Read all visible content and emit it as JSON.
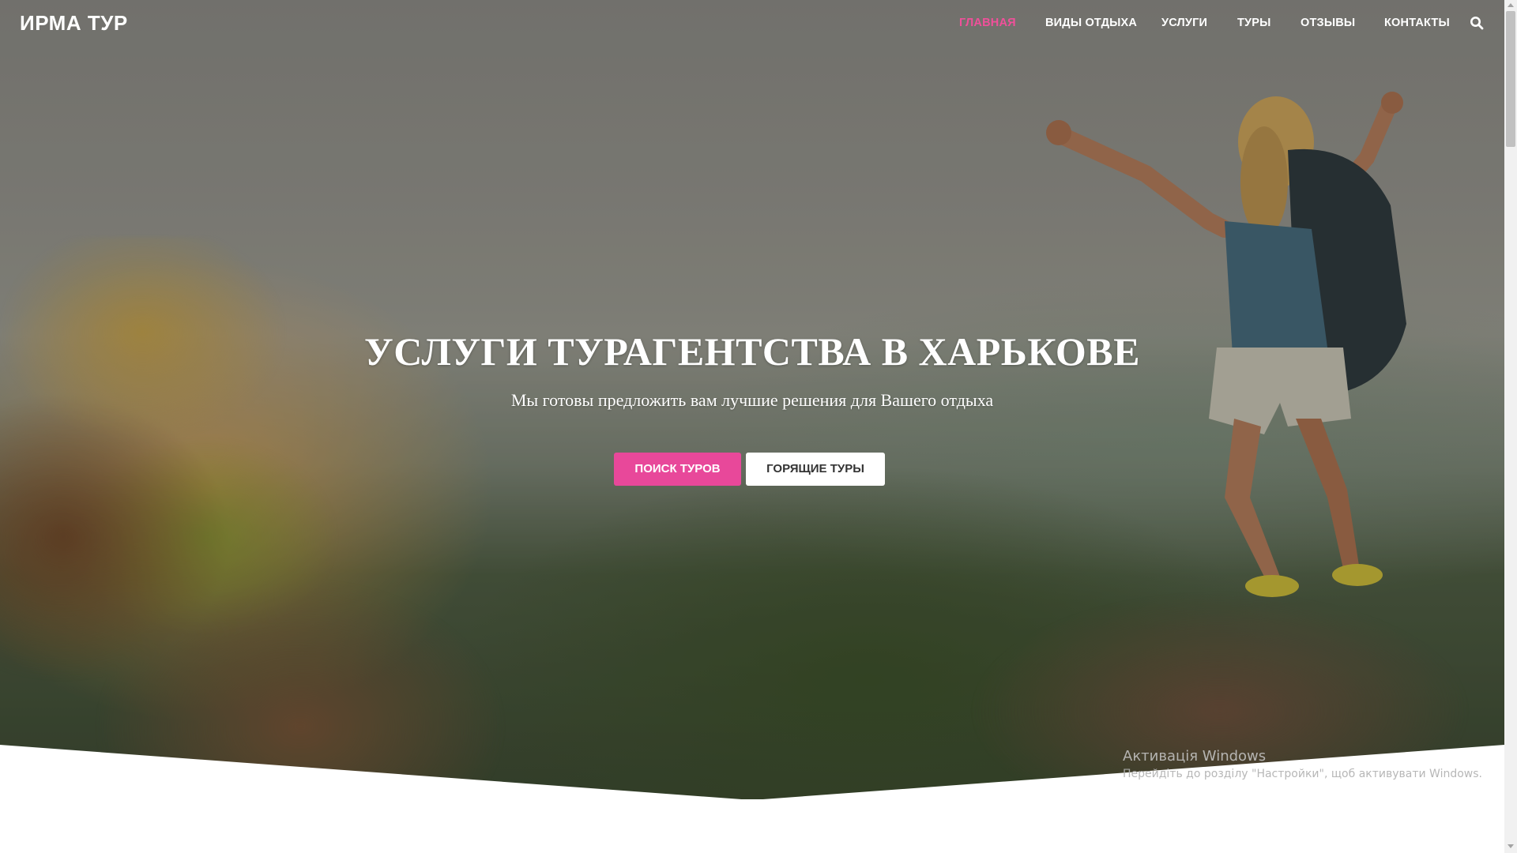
{
  "brand": {
    "logo_text": "ИРМА ТУР"
  },
  "nav": {
    "items": [
      {
        "label": "ГЛАВНАЯ",
        "active": true
      },
      {
        "label": "ВИДЫ ОТДЫХА",
        "active": false
      },
      {
        "label": "УСЛУГИ",
        "active": false
      },
      {
        "label": "ТУРЫ",
        "active": false
      },
      {
        "label": "ОТЗЫВЫ",
        "active": false
      },
      {
        "label": "КОНТАКТЫ",
        "active": false
      }
    ],
    "search_icon": "search-icon",
    "active_color": "#f0509a"
  },
  "hero": {
    "title": "УСЛУГИ ТУРАГЕНТСТВА В ХАРЬКОВЕ",
    "subtitle": "Мы готовы предложить вам лучшие решения для Вашего отдыха",
    "primary_button": "ПОИСК ТУРОВ",
    "secondary_button": "ГОРЯЩИЕ ТУРЫ",
    "primary_color": "#e8489a"
  },
  "watermark": {
    "title": "Активація Windows",
    "subtitle": "Перейдіть до розділу \"Настройки\", щоб активувати Windows."
  }
}
